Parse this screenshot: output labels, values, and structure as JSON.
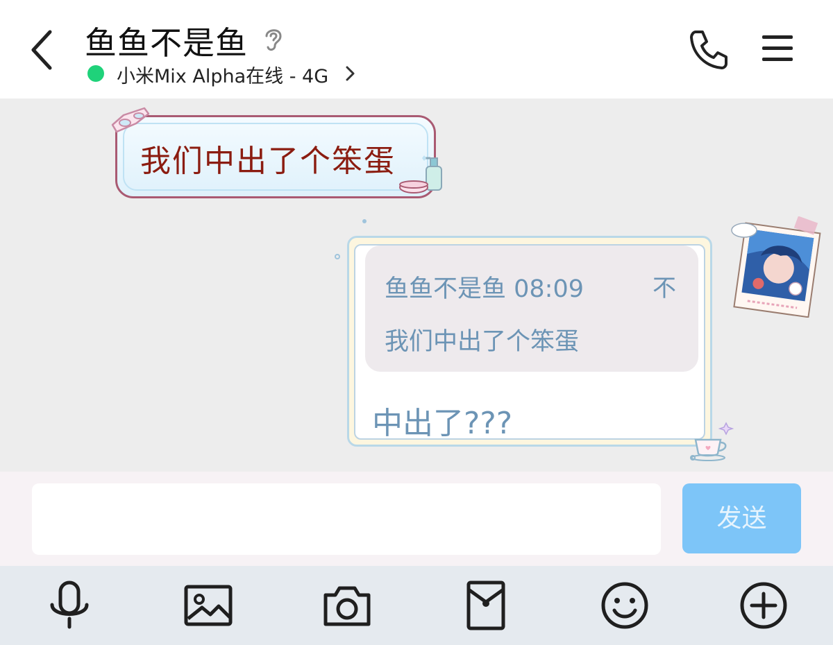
{
  "header": {
    "title": "鱼鱼不是鱼",
    "status": "小米Mix Alpha在线 - 4G"
  },
  "messages": {
    "received": {
      "text": "我们中出了个笨蛋"
    },
    "sent": {
      "quote_meta": "鱼鱼不是鱼 08:09",
      "quote_close": "不",
      "quote_text": "我们中出了个笨蛋",
      "text": "中出了???"
    }
  },
  "input": {
    "value": "",
    "send_label": "发送"
  },
  "colors": {
    "status_online": "#1fd27a",
    "send_button": "#7dc5f8",
    "received_text": "#8b1c10",
    "sent_text": "#6c94b5"
  },
  "toolbar": {
    "icons": [
      "microphone-icon",
      "image-icon",
      "camera-icon",
      "red-packet-icon",
      "emoji-icon",
      "add-icon"
    ]
  }
}
